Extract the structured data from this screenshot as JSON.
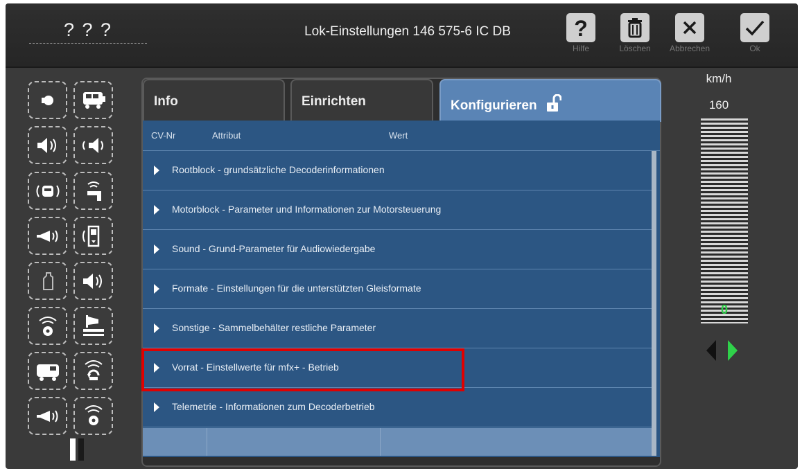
{
  "header": {
    "loco_name": "? ? ?",
    "title": "Lok-Einstellungen 146 575-6 IC DB",
    "buttons": {
      "help": "Hilfe",
      "delete": "Löschen",
      "cancel": "Abbrechen",
      "ok": "Ok"
    },
    "icons": {
      "help": "question-mark-icon",
      "delete": "trash-icon",
      "cancel": "close-icon",
      "ok": "checkmark-icon"
    }
  },
  "functions": [
    {
      "icon": "light-icon"
    },
    {
      "icon": "locomotive-icon"
    },
    {
      "icon": "sound-icon"
    },
    {
      "icon": "sound-reverse-icon"
    },
    {
      "icon": "radio-cab-icon"
    },
    {
      "icon": "coupler-sound-icon"
    },
    {
      "icon": "horn-icon"
    },
    {
      "icon": "door-sound-icon"
    },
    {
      "icon": "empty-function-icon"
    },
    {
      "icon": "announcement-icon"
    },
    {
      "icon": "radio-wheel-icon"
    },
    {
      "icon": "shunting-icon"
    },
    {
      "icon": "coach-icon"
    },
    {
      "icon": "compressor-icon"
    },
    {
      "icon": "whistle-icon"
    },
    {
      "icon": "sander-icon"
    }
  ],
  "tabs": {
    "info": "Info",
    "einrichten": "Einrichten",
    "konfigurieren": "Konfigurieren",
    "konfigurieren_icon": "unlock-icon"
  },
  "table": {
    "columns": [
      "CV-Nr",
      "Attribut",
      "Wert"
    ],
    "rows": [
      "Rootblock - grundsätzliche Decoderinformationen",
      "Motorblock - Parameter und Informationen zur Motorsteuerung",
      "Sound - Grund-Parameter für Audiowiedergabe",
      "Formate - Einstellungen für die unterstützten Gleisformate",
      "Sonstige - Sammelbehälter restliche Parameter",
      "Vorrat - Einstellwerte für mfx+ - Betrieb",
      "Telemetrie - Informationen zum Decoderbetrieb"
    ],
    "highlighted_row": 5
  },
  "speed": {
    "unit": "km/h",
    "max": "160",
    "current": "0",
    "direction": "forward"
  },
  "colors": {
    "accent_blue": "#5a84b5",
    "table_blue": "#2c5683",
    "highlight_red": "#e00000",
    "direction_green": "#2fd14a"
  }
}
